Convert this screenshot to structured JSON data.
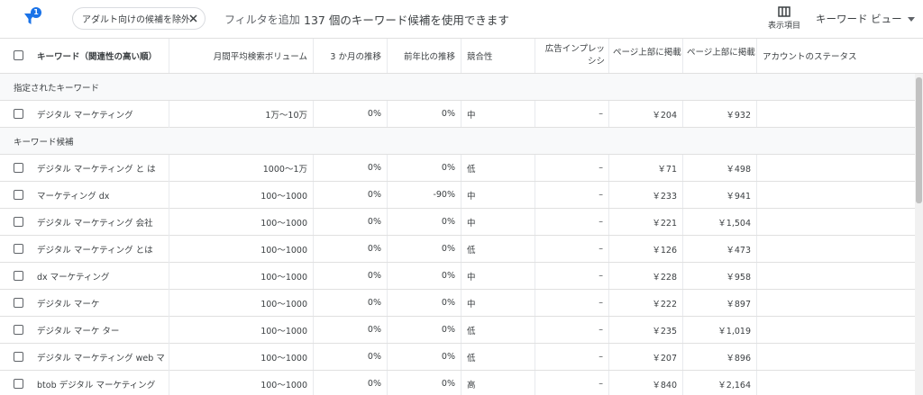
{
  "toolbar": {
    "filter_badge": "1",
    "chip_label": "アダルト向けの候補を除外",
    "add_filter": "フィルタを追加",
    "count_text": "137 個のキーワード候補を使用できます",
    "columns_label": "表示項目",
    "view_label": "キーワード ビュー"
  },
  "headers": {
    "keyword": "キーワード（関連性の高い順）",
    "volume": "月間平均検索ボリューム",
    "three_month": "3 か月の推移",
    "yoy": "前年比の推移",
    "competition": "競合性",
    "impression_share": "広告インプレッシシ",
    "low_bid": "ページ上部に掲載",
    "high_bid": "ページ上部に掲載",
    "status": "アカウントのステータス"
  },
  "sections": {
    "specified": "指定されたキーワード",
    "ideas": "キーワード候補"
  },
  "specified_rows": [
    {
      "keyword": "デジタル マーケティング",
      "volume": "1万～10万",
      "three_month": "0%",
      "yoy": "0%",
      "competition": "中",
      "impression_share": "–",
      "low_bid": "￥204",
      "high_bid": "￥932"
    }
  ],
  "idea_rows": [
    {
      "keyword": "デジタル マーケティング と は",
      "volume": "1000～1万",
      "three_month": "0%",
      "yoy": "0%",
      "competition": "低",
      "impression_share": "–",
      "low_bid": "￥71",
      "high_bid": "￥498"
    },
    {
      "keyword": "マーケティング dx",
      "volume": "100～1000",
      "three_month": "0%",
      "yoy": "-90%",
      "competition": "中",
      "impression_share": "–",
      "low_bid": "￥233",
      "high_bid": "￥941"
    },
    {
      "keyword": "デジタル マーケティング 会社",
      "volume": "100～1000",
      "three_month": "0%",
      "yoy": "0%",
      "competition": "中",
      "impression_share": "–",
      "low_bid": "￥221",
      "high_bid": "￥1,504"
    },
    {
      "keyword": "デジタル マーケティング とは",
      "volume": "100～1000",
      "three_month": "0%",
      "yoy": "0%",
      "competition": "低",
      "impression_share": "–",
      "low_bid": "￥126",
      "high_bid": "￥473"
    },
    {
      "keyword": "dx マーケティング",
      "volume": "100～1000",
      "three_month": "0%",
      "yoy": "0%",
      "competition": "中",
      "impression_share": "–",
      "low_bid": "￥228",
      "high_bid": "￥958"
    },
    {
      "keyword": "デジタル マーケ",
      "volume": "100～1000",
      "three_month": "0%",
      "yoy": "0%",
      "competition": "中",
      "impression_share": "–",
      "low_bid": "￥222",
      "high_bid": "￥897"
    },
    {
      "keyword": "デジタル マーケ ター",
      "volume": "100～1000",
      "three_month": "0%",
      "yoy": "0%",
      "competition": "低",
      "impression_share": "–",
      "low_bid": "￥235",
      "high_bid": "￥1,019"
    },
    {
      "keyword": "デジタル マーケティング web マ…",
      "volume": "100～1000",
      "three_month": "0%",
      "yoy": "0%",
      "competition": "低",
      "impression_share": "–",
      "low_bid": "￥207",
      "high_bid": "￥896"
    },
    {
      "keyword": "btob デジタル マーケティング",
      "volume": "100～1000",
      "three_month": "0%",
      "yoy": "0%",
      "competition": "高",
      "impression_share": "–",
      "low_bid": "￥840",
      "high_bid": "￥2,164"
    }
  ],
  "colors": {
    "accent": "#1a73e8",
    "section_bg": "#f8f9fa",
    "border": "#e0e0e0"
  }
}
